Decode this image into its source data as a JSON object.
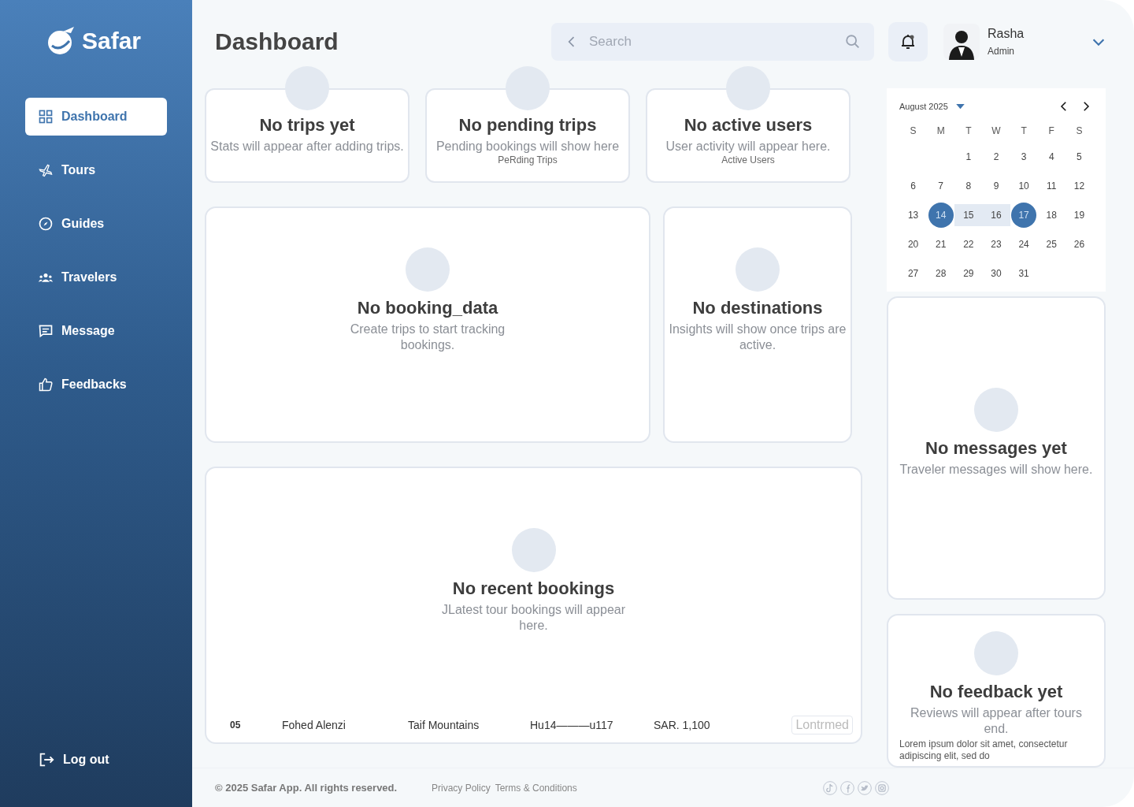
{
  "sidebar": {
    "logo": "Safar",
    "items": [
      {
        "label": "Dashboard",
        "selected": true
      },
      {
        "label": "Tours",
        "selected": false
      },
      {
        "label": "Guides",
        "selected": false
      },
      {
        "label": "Travelers",
        "selected": false
      },
      {
        "label": "Message",
        "selected": false
      },
      {
        "label": "Feedbacks",
        "selected": false
      }
    ],
    "logout": "Log out"
  },
  "header": {
    "title": "Dashboard",
    "search": {
      "placeholder": "Search"
    },
    "user": {
      "name": "Rasha",
      "role": "Admin"
    }
  },
  "stat_cards": [
    {
      "title": "No trips yet",
      "subtitle": "Stats will appear after adding trips."
    },
    {
      "title": "No pending trips",
      "subtitle": "Pending bookings will show here",
      "caption": "PeRding Trips"
    },
    {
      "title": "No active users",
      "subtitle": "User activity will appear here.",
      "caption": "Active Users"
    }
  ],
  "booking_chart": {
    "title": "No booking_data",
    "subtitle": "Create trips to start tracking bookings."
  },
  "destinations": {
    "title": "No destinations",
    "subtitle": "Insights will show once trips are active."
  },
  "recent_bookings": {
    "title": "No recent bookings",
    "subtitle": "JLatest tour bookings will appear here.",
    "rows": [
      {
        "number": "05",
        "name": "Fohed Alenzi",
        "destination": "Taif Mountains",
        "date": "Hu14———u117",
        "price": "SAR. 1,100",
        "status": "Lontrmed"
      }
    ]
  },
  "calendar": {
    "month": "August 2025",
    "weekdays": [
      "S",
      "M",
      "T",
      "W",
      "T",
      "F",
      "S"
    ],
    "days": [
      {
        "label": "1",
        "selected": false,
        "in_range": false
      },
      {
        "label": "2",
        "selected": false,
        "in_range": false
      },
      {
        "label": "3",
        "selected": false,
        "in_range": false
      },
      {
        "label": "4",
        "selected": false,
        "in_range": false
      },
      {
        "label": "5",
        "selected": false,
        "in_range": false
      },
      {
        "label": "6",
        "selected": false,
        "in_range": false
      },
      {
        "label": "7",
        "selected": false,
        "in_range": false
      },
      {
        "label": "8",
        "selected": false,
        "in_range": false
      },
      {
        "label": "9",
        "selected": false,
        "in_range": false
      },
      {
        "label": "10",
        "selected": false,
        "in_range": false
      },
      {
        "label": "11",
        "selected": false,
        "in_range": false
      },
      {
        "label": "12",
        "selected": false,
        "in_range": false
      },
      {
        "label": "13",
        "selected": false,
        "in_range": false
      },
      {
        "label": "14",
        "selected": true,
        "in_range": false
      },
      {
        "label": "15",
        "selected": false,
        "in_range": true
      },
      {
        "label": "16",
        "selected": false,
        "in_range": true
      },
      {
        "label": "17",
        "selected": true,
        "in_range": false
      },
      {
        "label": "18",
        "selected": false,
        "in_range": false
      },
      {
        "label": "19",
        "selected": false,
        "in_range": false
      },
      {
        "label": "20",
        "selected": false,
        "in_range": false
      },
      {
        "label": "21",
        "selected": false,
        "in_range": false
      },
      {
        "label": "22",
        "selected": false,
        "in_range": false
      },
      {
        "label": "23",
        "selected": false,
        "in_range": false
      },
      {
        "label": "24",
        "selected": false,
        "in_range": false
      },
      {
        "label": "25",
        "selected": false,
        "in_range": false
      },
      {
        "label": "26",
        "selected": false,
        "in_range": false
      },
      {
        "label": "27",
        "selected": false,
        "in_range": false
      },
      {
        "label": "28",
        "selected": false,
        "in_range": false
      },
      {
        "label": "29",
        "selected": false,
        "in_range": false
      },
      {
        "label": "30",
        "selected": false,
        "in_range": false
      },
      {
        "label": "31",
        "selected": false,
        "in_range": false
      }
    ]
  },
  "messages": {
    "title": "No messages yet",
    "subtitle": "Traveler messages will show here."
  },
  "feedback": {
    "title": "No feedback yet",
    "subtitle": "Reviews will appear after tours end.",
    "review_text": "Lorem ipsum dolor sit amet, consectetur adipiscing elit, sed do"
  },
  "footer": {
    "copyright": "© 2025 Safar App. All rights reserved.",
    "links": [
      "Privacy Policy",
      "Terms & Conditions"
    ]
  }
}
